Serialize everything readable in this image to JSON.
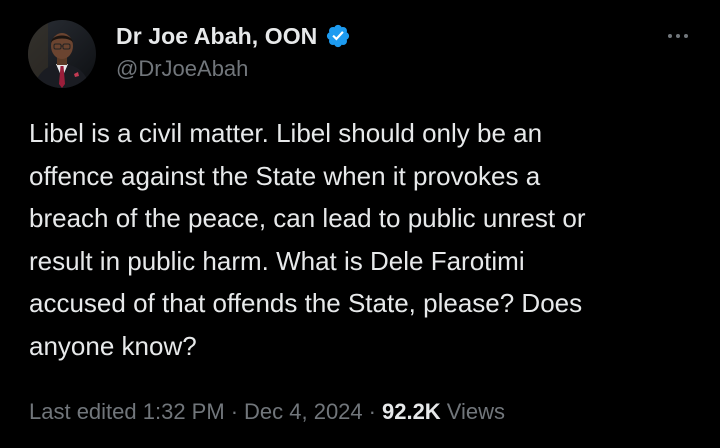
{
  "author": {
    "display_name": "Dr Joe Abah, OON",
    "handle": "@DrJoeAbah",
    "verified_color": "#1d9bf0"
  },
  "tweet": {
    "text_lines": [
      "Libel is a civil matter. Libel should only be an",
      "offence against the State when it provokes a",
      "breach of the peace, can lead to public unrest or",
      "result in public harm. What is Dele Farotimi",
      "accused of that offends the State, please? Does",
      "anyone know?"
    ]
  },
  "meta": {
    "edited_label": "Last edited 1:32 PM",
    "separator": "·",
    "date": "Dec 4, 2024",
    "views_count": "92.2K",
    "views_label": "Views"
  },
  "icons": {
    "more": "more-horizontal-icon",
    "verified": "verified-badge-icon"
  },
  "colors": {
    "background": "#000000",
    "primary_text": "#e7e9ea",
    "secondary_text": "#71767b",
    "accent": "#1d9bf0"
  }
}
